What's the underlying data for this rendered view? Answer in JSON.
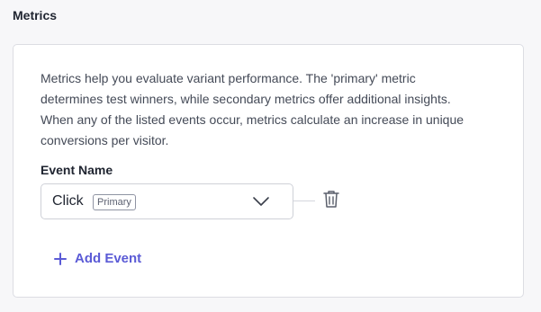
{
  "section": {
    "title": "Metrics"
  },
  "card": {
    "description_lines": [
      "Metrics help you evaluate variant performance. The 'primary' metric",
      "determines test winners, while secondary metrics offer additional insights.",
      "When any of the listed events occur, metrics calculate an increase in unique",
      "conversions per visitor."
    ],
    "field_label": "Event Name",
    "event_select": {
      "value": "Click",
      "badge": "Primary",
      "icon": "chevron-down-icon"
    },
    "delete_icon": "trash-icon",
    "add_event": {
      "icon": "plus-icon",
      "label": "Add Event"
    }
  },
  "colors": {
    "accent": "#5b5bd6",
    "border": "#dcdde3",
    "text": "#1f2430",
    "muted_text": "#444a57"
  }
}
